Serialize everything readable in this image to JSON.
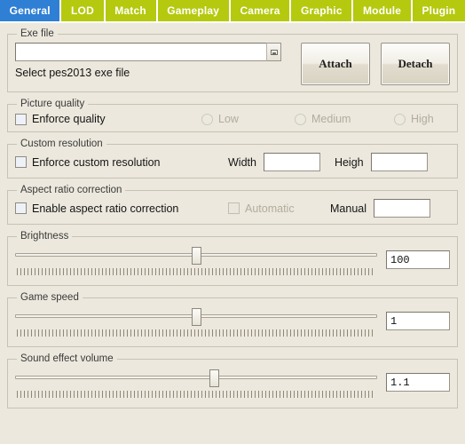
{
  "theme": {
    "tab_bg": "#b5c90e",
    "tab_active_bg": "#2f7fd4",
    "page_bg": "#ece8dd",
    "border": "#c8c2b4"
  },
  "tabs": [
    {
      "label": "General",
      "active": true
    },
    {
      "label": "LOD",
      "active": false
    },
    {
      "label": "Match",
      "active": false
    },
    {
      "label": "Gameplay",
      "active": false
    },
    {
      "label": "Camera",
      "active": false
    },
    {
      "label": "Graphic",
      "active": false
    },
    {
      "label": "Module",
      "active": false
    },
    {
      "label": "Plugin",
      "active": false
    }
  ],
  "exe_file": {
    "legend": "Exe file",
    "input_value": "",
    "input_placeholder": "",
    "browse_icon": "browse-icon",
    "hint": "Select pes2013 exe file",
    "attach_label": "Attach",
    "detach_label": "Detach"
  },
  "picture_quality": {
    "legend": "Picture quality",
    "enforce_label": "Enforce quality",
    "enforce_checked": false,
    "options": [
      {
        "label": "Low",
        "selected": false,
        "disabled": true
      },
      {
        "label": "Medium",
        "selected": false,
        "disabled": true
      },
      {
        "label": "High",
        "selected": false,
        "disabled": true
      }
    ]
  },
  "custom_resolution": {
    "legend": "Custom resolution",
    "enforce_label": "Enforce custom resolution",
    "enforce_checked": false,
    "width_label": "Width",
    "width_value": "",
    "height_label": "Heigh",
    "height_value": ""
  },
  "aspect_ratio": {
    "legend": "Aspect ratio correction",
    "enable_label": "Enable aspect ratio correction",
    "enable_checked": false,
    "automatic_label": "Automatic",
    "automatic_checked": false,
    "automatic_disabled": true,
    "manual_label": "Manual",
    "manual_value": ""
  },
  "brightness": {
    "legend": "Brightness",
    "value": "100",
    "thumb_percent": 50
  },
  "game_speed": {
    "legend": "Game speed",
    "value": "1",
    "thumb_percent": 50
  },
  "sound_effect_volume": {
    "legend": "Sound effect volume",
    "value": "1.1",
    "thumb_percent": 55
  }
}
